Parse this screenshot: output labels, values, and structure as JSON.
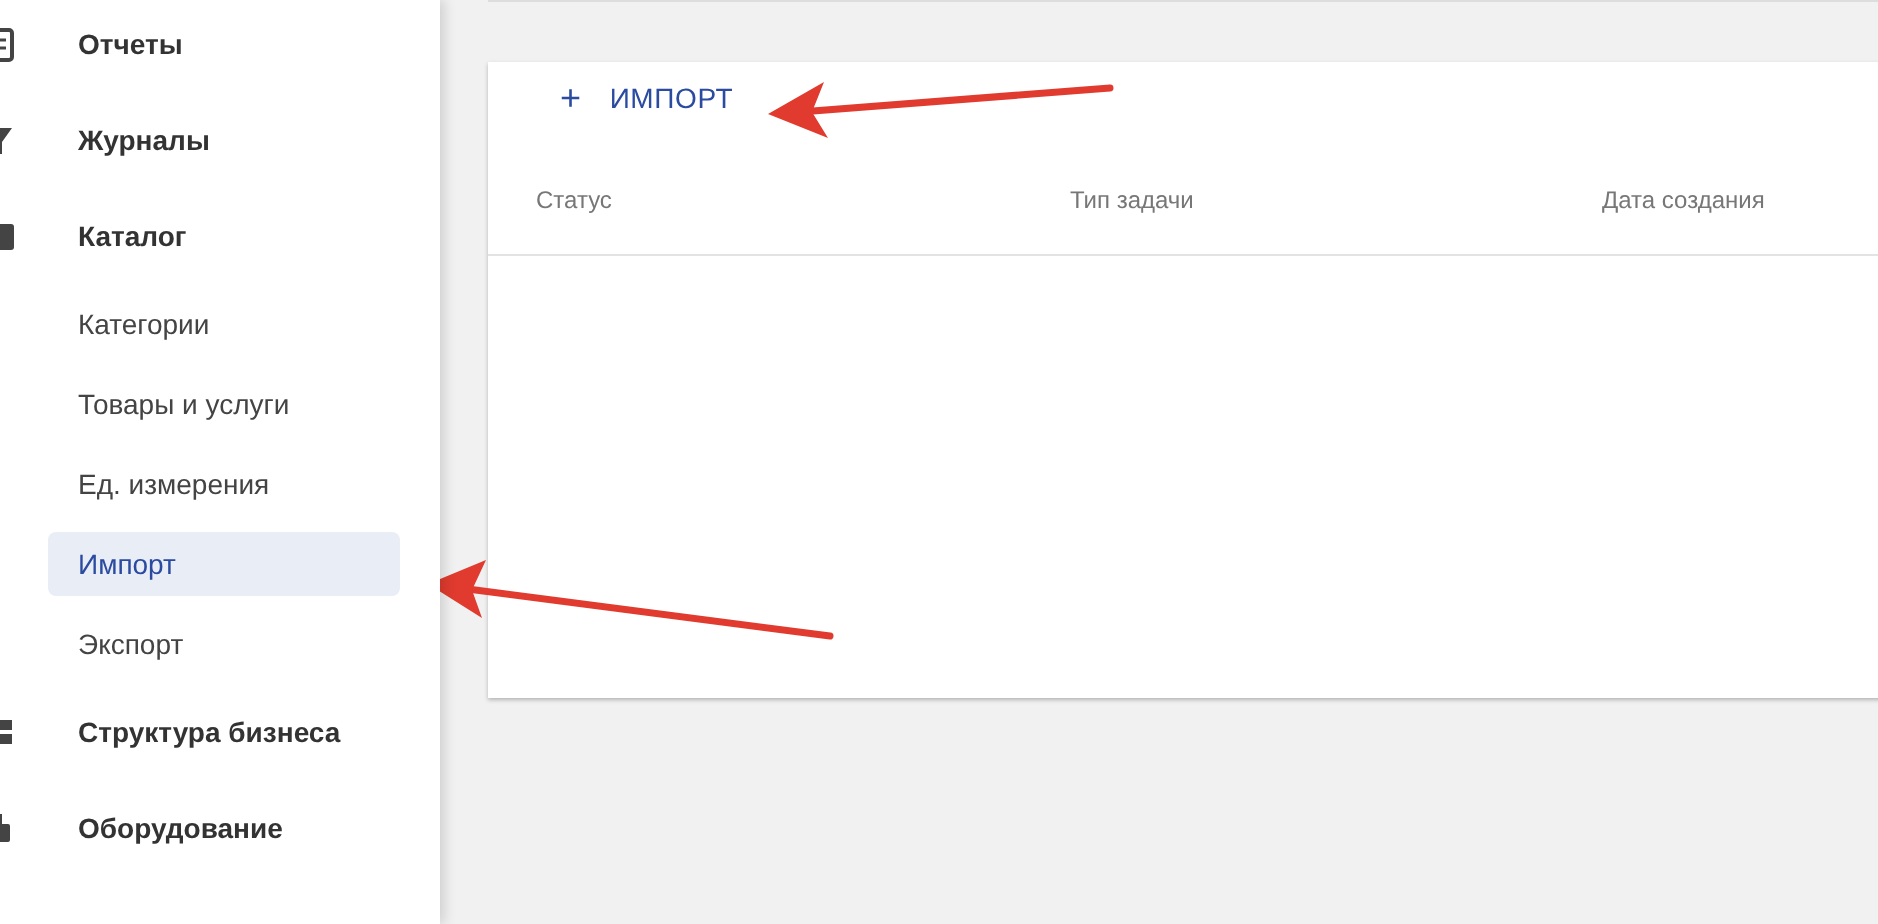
{
  "sidebar": {
    "items": [
      {
        "kind": "section",
        "label": "Отчеты",
        "selected": false
      },
      {
        "kind": "section",
        "label": "Журналы",
        "selected": false
      },
      {
        "kind": "section",
        "label": "Каталог",
        "selected": false
      },
      {
        "kind": "sub",
        "label": "Категории",
        "selected": false
      },
      {
        "kind": "sub",
        "label": "Товары и услуги",
        "selected": false
      },
      {
        "kind": "sub",
        "label": "Ед. измерения",
        "selected": false
      },
      {
        "kind": "sub",
        "label": "Импорт",
        "selected": true
      },
      {
        "kind": "sub",
        "label": "Экспорт",
        "selected": false
      },
      {
        "kind": "section",
        "label": "Структура бизнеса",
        "selected": false
      },
      {
        "kind": "section",
        "label": "Оборудование",
        "selected": false
      }
    ]
  },
  "import_button": {
    "icon": "+",
    "label": "ИМПОРТ"
  },
  "table": {
    "columns": [
      "Статус",
      "Тип задачи",
      "Дата создания"
    ]
  }
}
